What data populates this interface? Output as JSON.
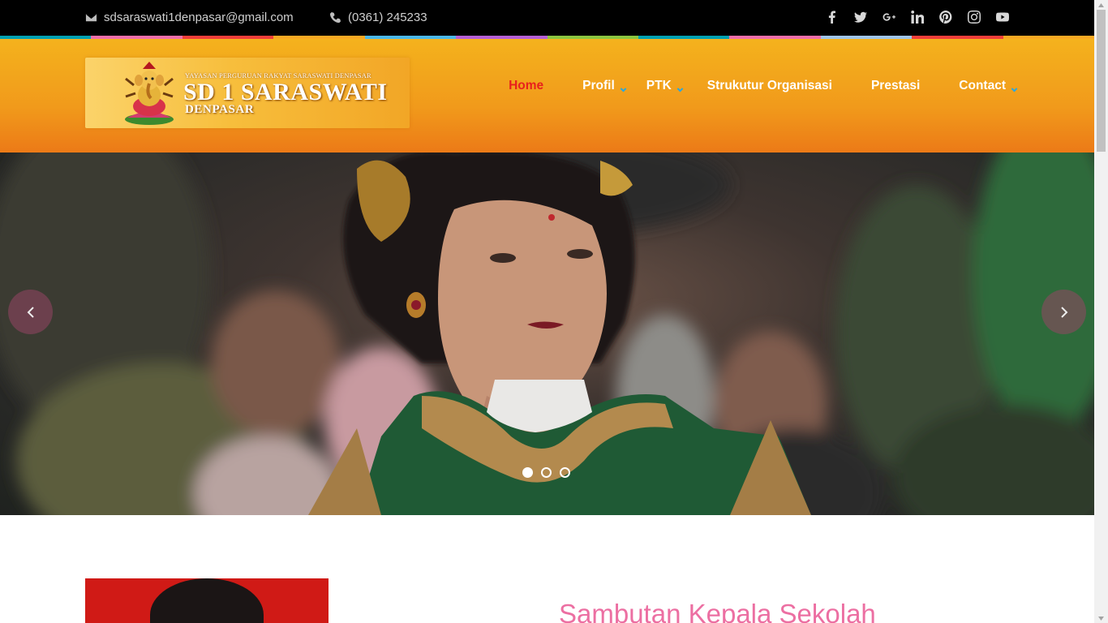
{
  "topbar": {
    "email": "sdsaraswati1denpasar@gmail.com",
    "phone": "(0361) 245233",
    "socials": [
      "facebook-icon",
      "twitter-icon",
      "google-plus-icon",
      "linkedin-icon",
      "pinterest-icon",
      "instagram-icon",
      "youtube-icon"
    ]
  },
  "stripe_colors": [
    "#00a0b0",
    "#f06ea9",
    "#ef3e3a",
    "#f7a823",
    "#4bb7e6",
    "#b55fd5",
    "#8bc53f",
    "#00a0b0",
    "#f06ea9",
    "#9fc5e8",
    "#ef3e3a",
    "#f7a823"
  ],
  "logo": {
    "subtitle": "YAYASAN PERGURUAN RAKYAT SARASWATI DENPASAR",
    "title": "SD 1 SARASWATI",
    "city": "DENPASAR"
  },
  "nav": [
    {
      "label": "Home",
      "active": true,
      "dropdown": false
    },
    {
      "label": "Profil",
      "active": false,
      "dropdown": true
    },
    {
      "label": "PTK",
      "active": false,
      "dropdown": true
    },
    {
      "label": "Strukutur Organisasi",
      "active": false,
      "dropdown": false
    },
    {
      "label": "Prestasi",
      "active": false,
      "dropdown": false
    },
    {
      "label": "Contact",
      "active": false,
      "dropdown": true
    }
  ],
  "slider": {
    "slides": 3,
    "active_slide": 1
  },
  "content": {
    "heading": "Sambutan Kepala Sekolah"
  },
  "colors": {
    "header_top": "#f4b21d",
    "header_bottom": "#ec7a17",
    "active_nav": "#e8201c",
    "chevron": "#29a8e0",
    "heading": "#ec6fa2"
  }
}
